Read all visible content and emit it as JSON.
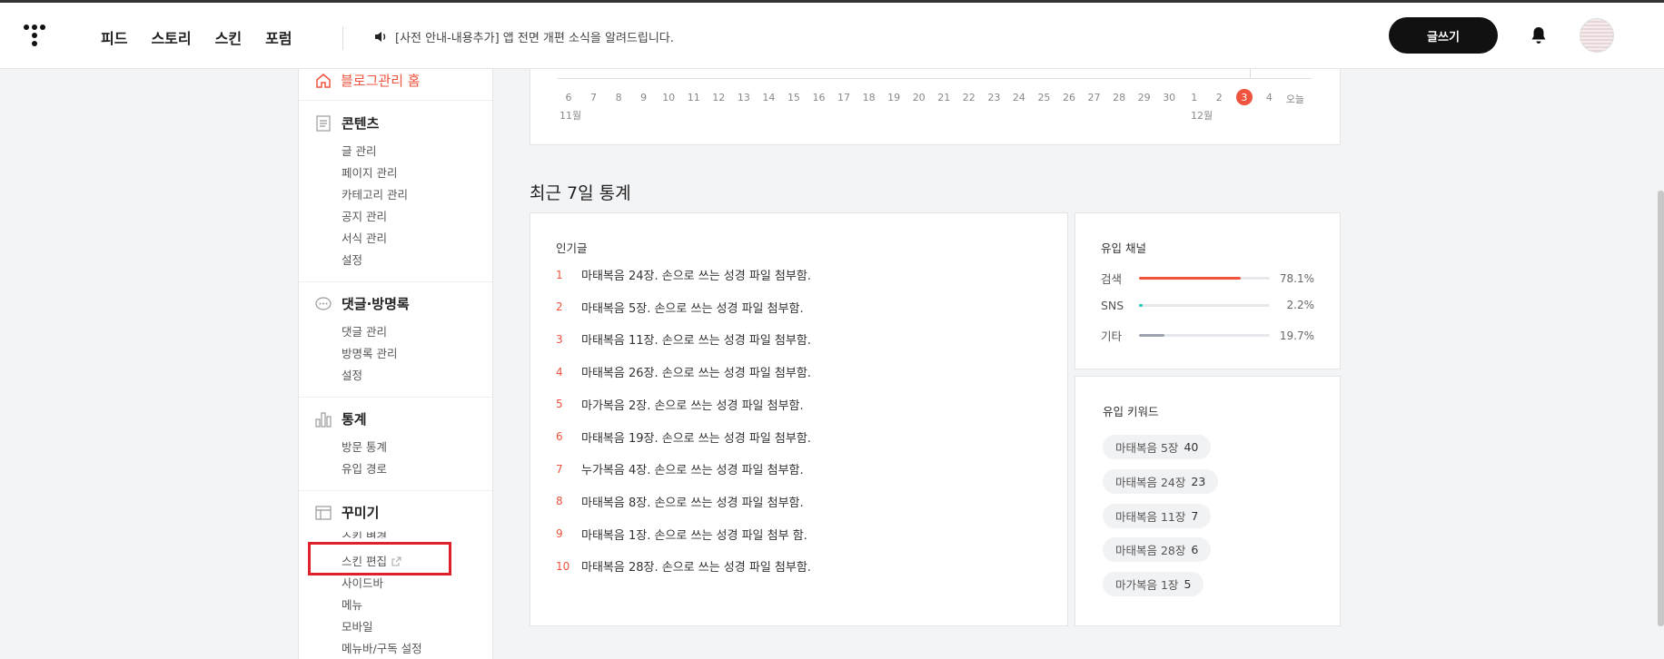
{
  "header": {
    "nav": [
      "피드",
      "스토리",
      "스킨",
      "포럼"
    ],
    "notice": "[사전 안내-내용추가] 앱 전면 개편 소식을 알려드립니다.",
    "write_label": "글쓰기"
  },
  "sidebar": {
    "home_label": "블로그관리 홈",
    "sections": [
      {
        "title": "콘텐츠",
        "icon": "document-icon",
        "items": [
          "글 관리",
          "페이지 관리",
          "카테고리 관리",
          "공지 관리",
          "서식 관리",
          "설정"
        ]
      },
      {
        "title": "댓글·방명록",
        "icon": "comment-icon",
        "items": [
          "댓글 관리",
          "방명록 관리",
          "설정"
        ]
      },
      {
        "title": "통계",
        "icon": "bar-chart-icon",
        "items": [
          "방문 통계",
          "유입 경로"
        ]
      },
      {
        "title": "꾸미기",
        "icon": "layout-icon",
        "items": [
          "스킨 변경",
          "스킨 편집",
          "사이드바",
          "메뉴",
          "모바일",
          "메뉴바/구독 설정"
        ]
      }
    ]
  },
  "timeline": {
    "days": [
      "6",
      "7",
      "8",
      "9",
      "10",
      "11",
      "12",
      "13",
      "14",
      "15",
      "16",
      "17",
      "18",
      "19",
      "20",
      "21",
      "22",
      "23",
      "24",
      "25",
      "26",
      "27",
      "28",
      "29",
      "30",
      "1",
      "2",
      "3",
      "4",
      "오늘"
    ],
    "active_day": "3",
    "months": [
      "11월",
      "12월"
    ]
  },
  "stats": {
    "title": "최근 7일 통계",
    "popular": {
      "title": "인기글",
      "items": [
        {
          "rank": "1",
          "title": "마태복음 24장. 손으로 쓰는 성경 파일 첨부함."
        },
        {
          "rank": "2",
          "title": "마태복음 5장. 손으로 쓰는 성경 파일 첨부함."
        },
        {
          "rank": "3",
          "title": "마태복음 11장. 손으로 쓰는 성경 파일 첨부함."
        },
        {
          "rank": "4",
          "title": "마태복음 26장. 손으로 쓰는 성경 파일 첨부함."
        },
        {
          "rank": "5",
          "title": "마가복음 2장. 손으로 쓰는 성경 파일 첨부함."
        },
        {
          "rank": "6",
          "title": "마태복음 19장. 손으로 쓰는 성경 파일 첨부함."
        },
        {
          "rank": "7",
          "title": "누가복음 4장. 손으로 쓰는 성경 파일 첨부함."
        },
        {
          "rank": "8",
          "title": "마태복음 8장. 손으로 쓰는 성경 파일 첨부함."
        },
        {
          "rank": "9",
          "title": "마태복음 1장. 손으로 쓰는 성경 파일 첨부 함."
        },
        {
          "rank": "10",
          "title": "마태복음 28장. 손으로 쓰는 성경 파일 첨부함."
        }
      ]
    },
    "channels": {
      "title": "유입 채널",
      "items": [
        {
          "label": "검색",
          "percent": "78.1%",
          "fraction": 0.781,
          "color": "#f0533e"
        },
        {
          "label": "SNS",
          "percent": "2.2%",
          "fraction": 0.022,
          "color": "#1fc9b8"
        },
        {
          "label": "기타",
          "percent": "19.7%",
          "fraction": 0.197,
          "color": "#9aa3af"
        }
      ]
    },
    "keywords": {
      "title": "유입 키워드",
      "items": [
        {
          "keyword": "마태복음 5장",
          "count": "40"
        },
        {
          "keyword": "마태복음 24장",
          "count": "23"
        },
        {
          "keyword": "마태복음 11장",
          "count": "7"
        },
        {
          "keyword": "마태복음 28장",
          "count": "6"
        },
        {
          "keyword": "마가복음 1장",
          "count": "5"
        }
      ]
    }
  },
  "colors": {
    "accent": "#f0533e",
    "highlight": "#e0202a"
  }
}
